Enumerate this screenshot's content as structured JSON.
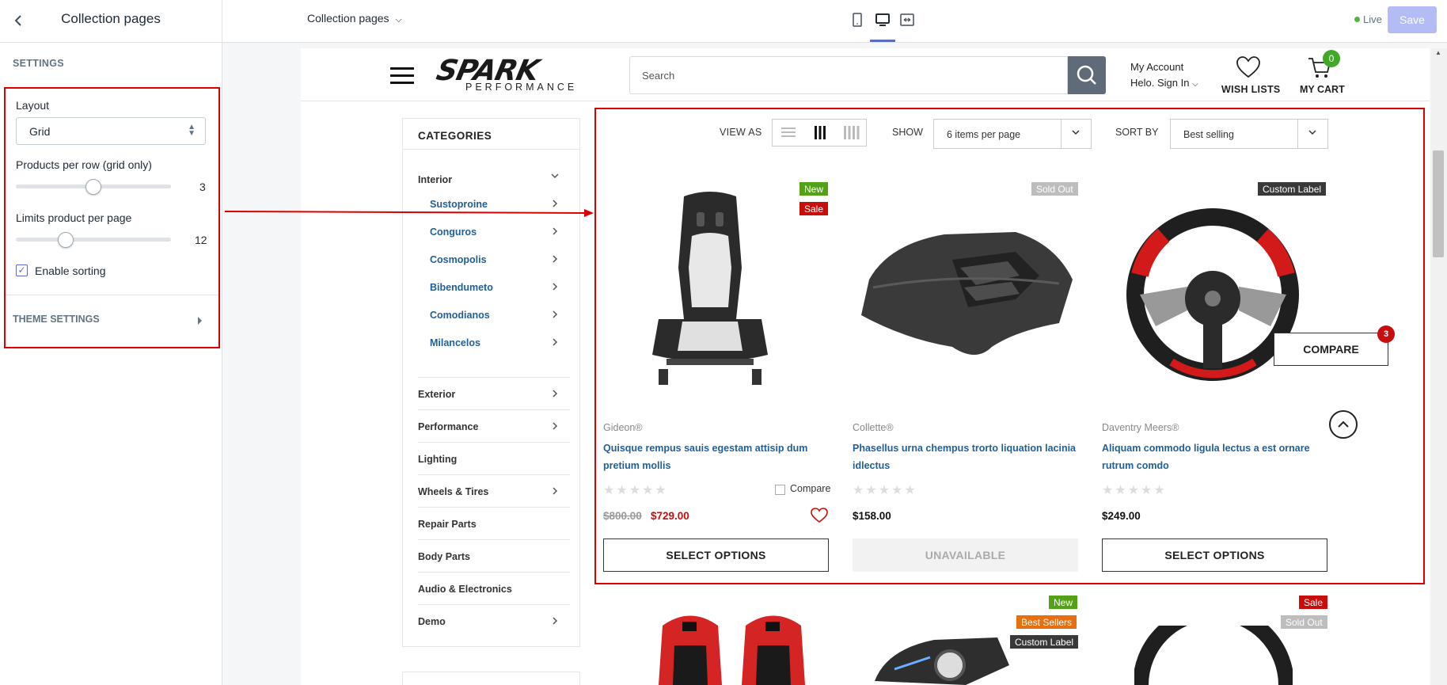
{
  "editor": {
    "panel_title": "Collection pages",
    "settings_heading": "SETTINGS",
    "layout_label": "Layout",
    "layout_value": "Grid",
    "per_row_label": "Products per row (grid only)",
    "per_row_value": "3",
    "limits_label": "Limits product per page",
    "limits_value": "12",
    "enable_sorting_label": "Enable sorting",
    "theme_settings": "THEME SETTINGS",
    "page_select": "Collection pages",
    "live_label": "Live",
    "save_label": "Save",
    "live_color": "#50b83c",
    "accent_color": "#5c6ac4"
  },
  "site": {
    "logo_main": "SPARK",
    "logo_sub": "PERFORMANCE",
    "search_placeholder": "Search",
    "account_label": "My Account",
    "account_sub": "Helo. Sign In",
    "wishlist_label": "WISH LISTS",
    "cart_label": "MY CART",
    "cart_count": "0"
  },
  "categories": {
    "title": "CATEGORIES",
    "main": "Interior",
    "sub": [
      "Sustoproine",
      "Conguros",
      "Cosmopolis",
      "Bibendumeto",
      "Comodianos",
      "Milancelos"
    ],
    "items": [
      "Exterior",
      "Performance",
      "Lighting",
      "Wheels & Tires",
      "Repair Parts",
      "Body Parts",
      "Audio & Electronics",
      "Demo"
    ]
  },
  "toolbar": {
    "view_as": "VIEW AS",
    "show": "SHOW",
    "show_value": "6 items per page",
    "sort_by": "SORT BY",
    "sort_value": "Best selling"
  },
  "products": [
    {
      "badges": [
        "New",
        "Sale"
      ],
      "brand": "Gideon®",
      "title": "Quisque rempus sauis egestam attisip dum pretium mollis",
      "old_price": "$800.00",
      "price": "$729.00",
      "compare_label": "Compare",
      "button": "SELECT OPTIONS"
    },
    {
      "badges": [
        "Sold Out"
      ],
      "brand": "Collette®",
      "title": "Phasellus urna chempus trorto liquation lacinia idlectus",
      "price": "$158.00",
      "button": "UNAVAILABLE"
    },
    {
      "badges": [
        "Custom Label"
      ],
      "brand": "Daventry Meers®",
      "title": "Aliquam commodo ligula lectus a est ornare rutrum comdo",
      "price": "$249.00",
      "button": "SELECT OPTIONS"
    }
  ],
  "row2_badges": {
    "p1": [],
    "p2": [
      "New",
      "Best Sellers",
      "Custom Label"
    ],
    "p3": [
      "Sale",
      "Sold Out"
    ]
  },
  "compare": {
    "label": "COMPARE",
    "count": "3"
  }
}
